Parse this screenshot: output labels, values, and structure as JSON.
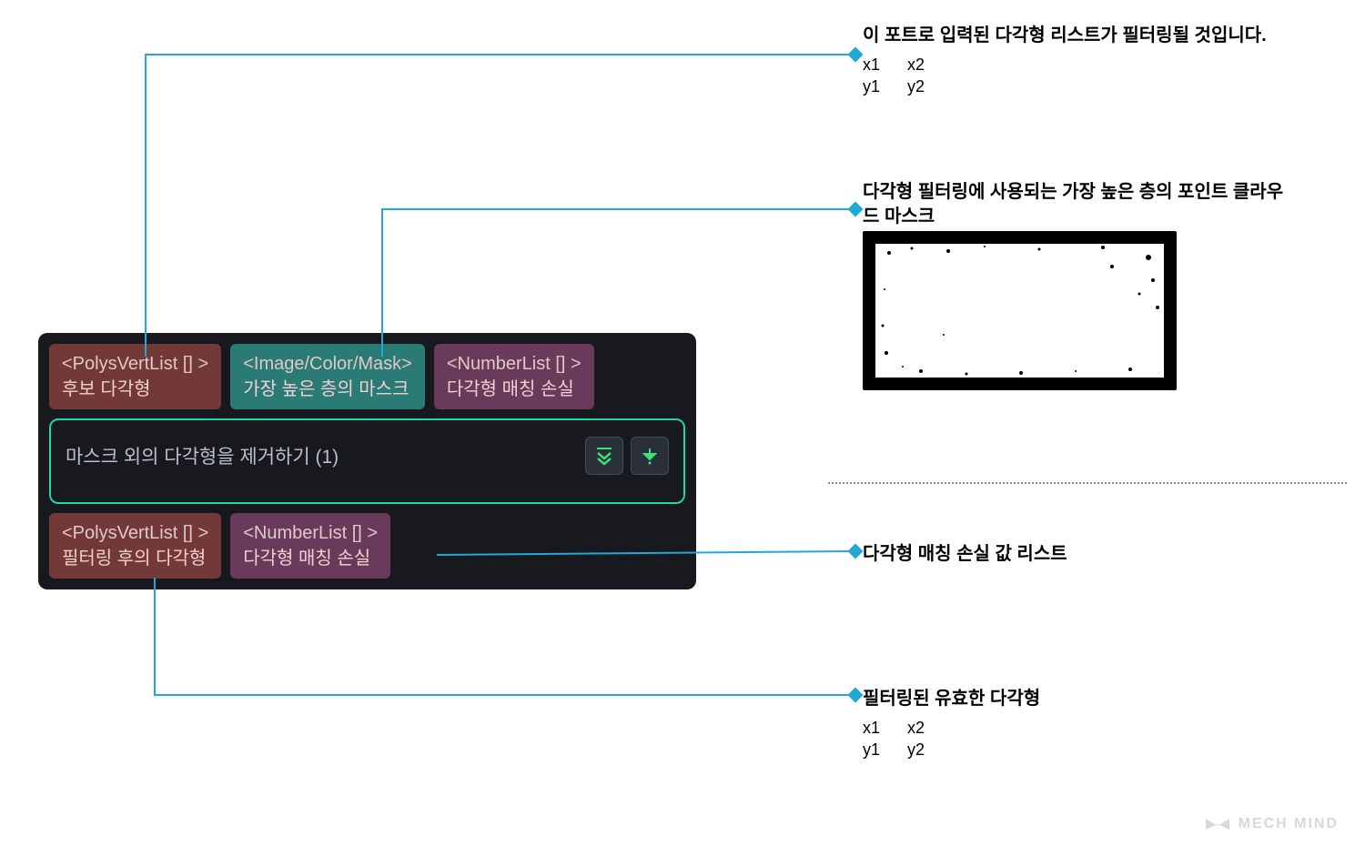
{
  "node": {
    "title": "마스크 외의 다각형을 제거하기 (1)",
    "inputs": {
      "polys": {
        "type": "<PolysVertList [] >",
        "label": "후보 다각형"
      },
      "mask": {
        "type": "<Image/Color/Mask>",
        "label": "가장 높은 층의 마스크"
      },
      "loss": {
        "type": "<NumberList [] >",
        "label": "다각형 매칭 손실"
      }
    },
    "outputs": {
      "filtered": {
        "type": "<PolysVertList [] >",
        "label": "필터링 후의 다각형"
      },
      "loss": {
        "type": "<NumberList [] >",
        "label": "다각형 매칭 손실"
      }
    }
  },
  "annotations": {
    "a1": {
      "title": "이 포트로 입력된 다각형 리스트가 필터링될 것입니다.",
      "sub": {
        "x1": "x1",
        "x2": "x2",
        "y1": "y1",
        "y2": "y2"
      }
    },
    "a2": {
      "title": "다각형 필터링에 사용되는 가장 높은 층의 포인트 클라우드 마스크"
    },
    "a3": {
      "title": "다각형 매칭 손실 값 리스트"
    },
    "a4": {
      "title": "필터링된 유효한 다각형",
      "sub": {
        "x1": "x1",
        "x2": "x2",
        "y1": "y1",
        "y2": "y2"
      }
    }
  },
  "watermark": "MECH MIND",
  "colors": {
    "connector": "#1fa8d8"
  }
}
